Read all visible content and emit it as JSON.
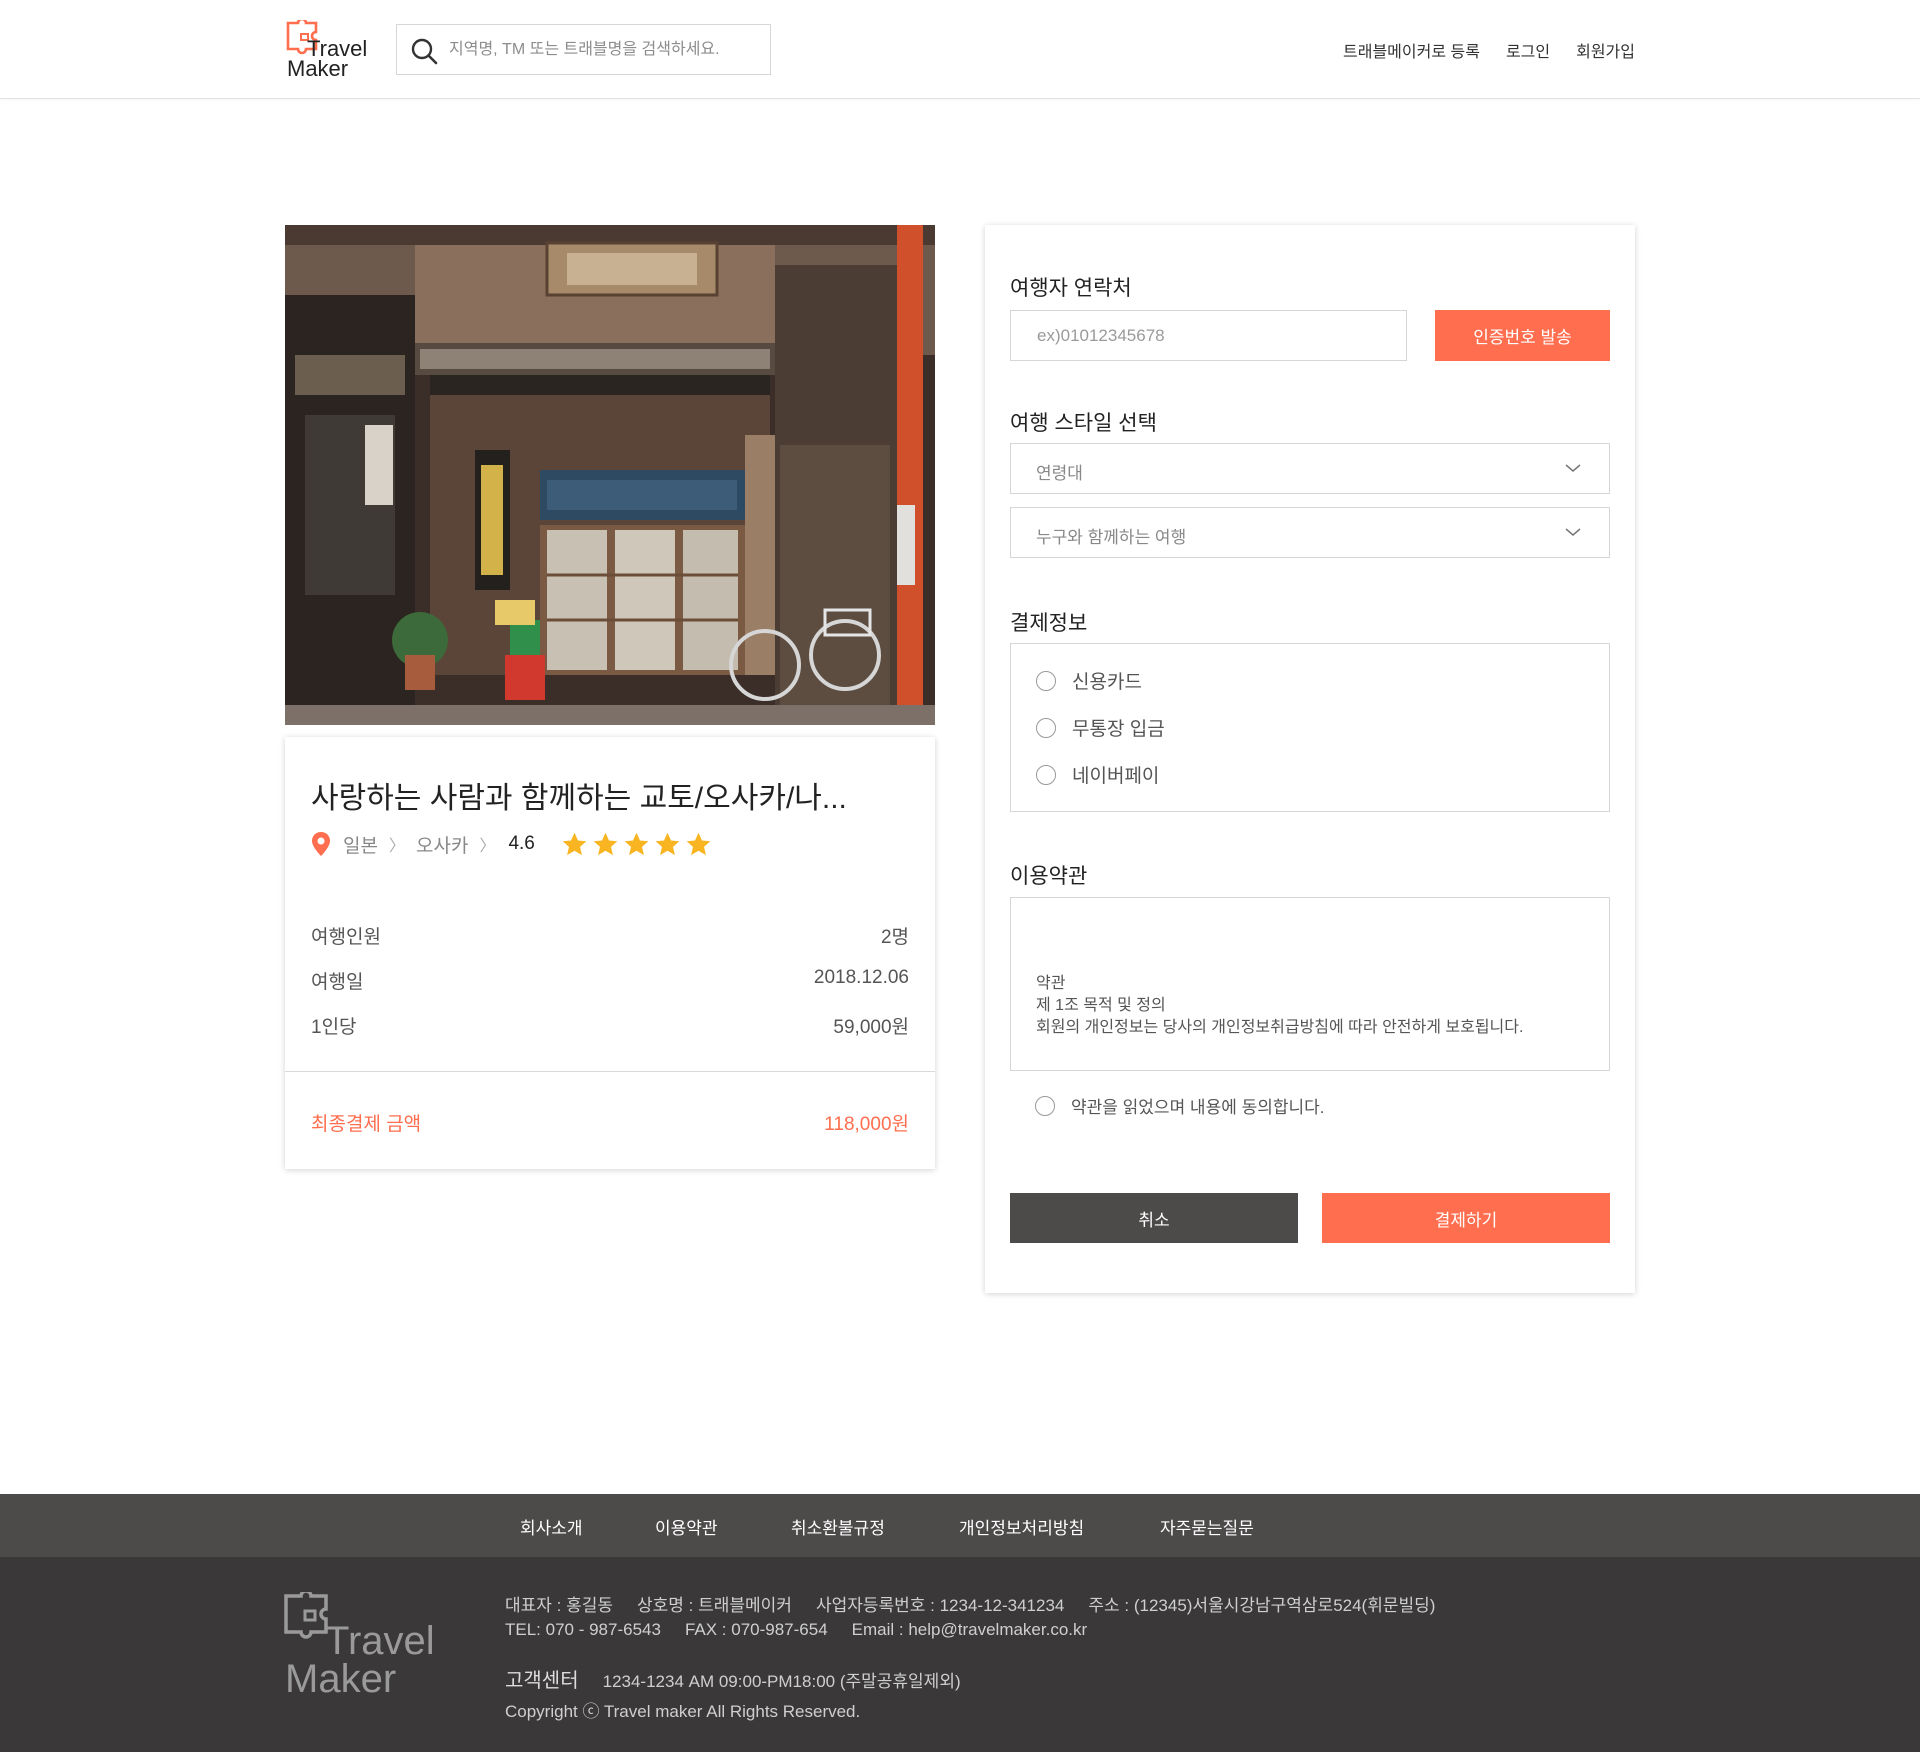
{
  "header": {
    "brand_line1": "Travel",
    "brand_line2": "Maker",
    "search_placeholder": "지역명, TM 또는 트래블명을 검색하세요.",
    "nav": [
      "트래블메이커로 등록",
      "로그인",
      "회원가입"
    ]
  },
  "product": {
    "title": "사랑하는 사람과 함께하는 교토/오사카/나...",
    "country": "일본",
    "city": "오사카",
    "rating": "4.6",
    "stars": 5,
    "rows": [
      {
        "label": "여행인원",
        "value": "2명"
      },
      {
        "label": "여행일",
        "value": "2018.12.06"
      },
      {
        "label": "1인당",
        "value": "59,000원"
      }
    ],
    "total_label": "최종결제 금액",
    "total_value": "118,000원"
  },
  "form": {
    "contact_title": "여행자 연락처",
    "phone_placeholder": "ex)01012345678",
    "verify_button": "인증번호 발송",
    "style_title": "여행 스타일 선택",
    "select_age": "연령대",
    "select_companion": "누구와 함께하는 여행",
    "payment_title": "결제정보",
    "payment_options": [
      "신용카드",
      "무통장 입금",
      "네이버페이"
    ],
    "terms_title": "이용약관",
    "terms_lines": [
      "약관",
      "제 1조 목적 및 정의",
      "회원의 개인정보는 당사의 개인정보취급방침에 따라 안전하게 보호됩니다."
    ],
    "agree_label": "약관을 읽었으며 내용에 동의합니다.",
    "cancel_button": "취소",
    "pay_button": "결제하기"
  },
  "footer": {
    "nav": [
      "회사소개",
      "이용약관",
      "취소환불규정",
      "개인정보처리방침",
      "자주묻는질문"
    ],
    "brand_line1": "Travel",
    "brand_line2": "Maker",
    "info_line1": [
      "대표자 : 홍길동",
      "상호명 : 트래블메이커",
      "사업자등록번호 : 1234-12-341234",
      "주소 : (12345)서울시강남구역삼로524(휘문빌딩)"
    ],
    "info_line2": [
      "TEL: 070 - 987-6543",
      "FAX : 070-987-654",
      "Email : help@travelmaker.co.kr"
    ],
    "cs_title": "고객센터",
    "cs_info": "1234-1234   AM 09:00-PM18:00 (주말공휴일제외)",
    "copyright": "Copyright ⓒ Travel maker All Rights Reserved."
  },
  "colors": {
    "accent": "#ff6e4e",
    "dark_button": "#4d4a4a",
    "footer_nav_bg": "#4d4a4a",
    "footer_bg": "#3a3838",
    "star": "#f8b521"
  },
  "icons": [
    "puzzle-logo-icon",
    "search-icon",
    "location-pin-icon",
    "star-icon",
    "chevron-down-icon",
    "radio-icon"
  ]
}
